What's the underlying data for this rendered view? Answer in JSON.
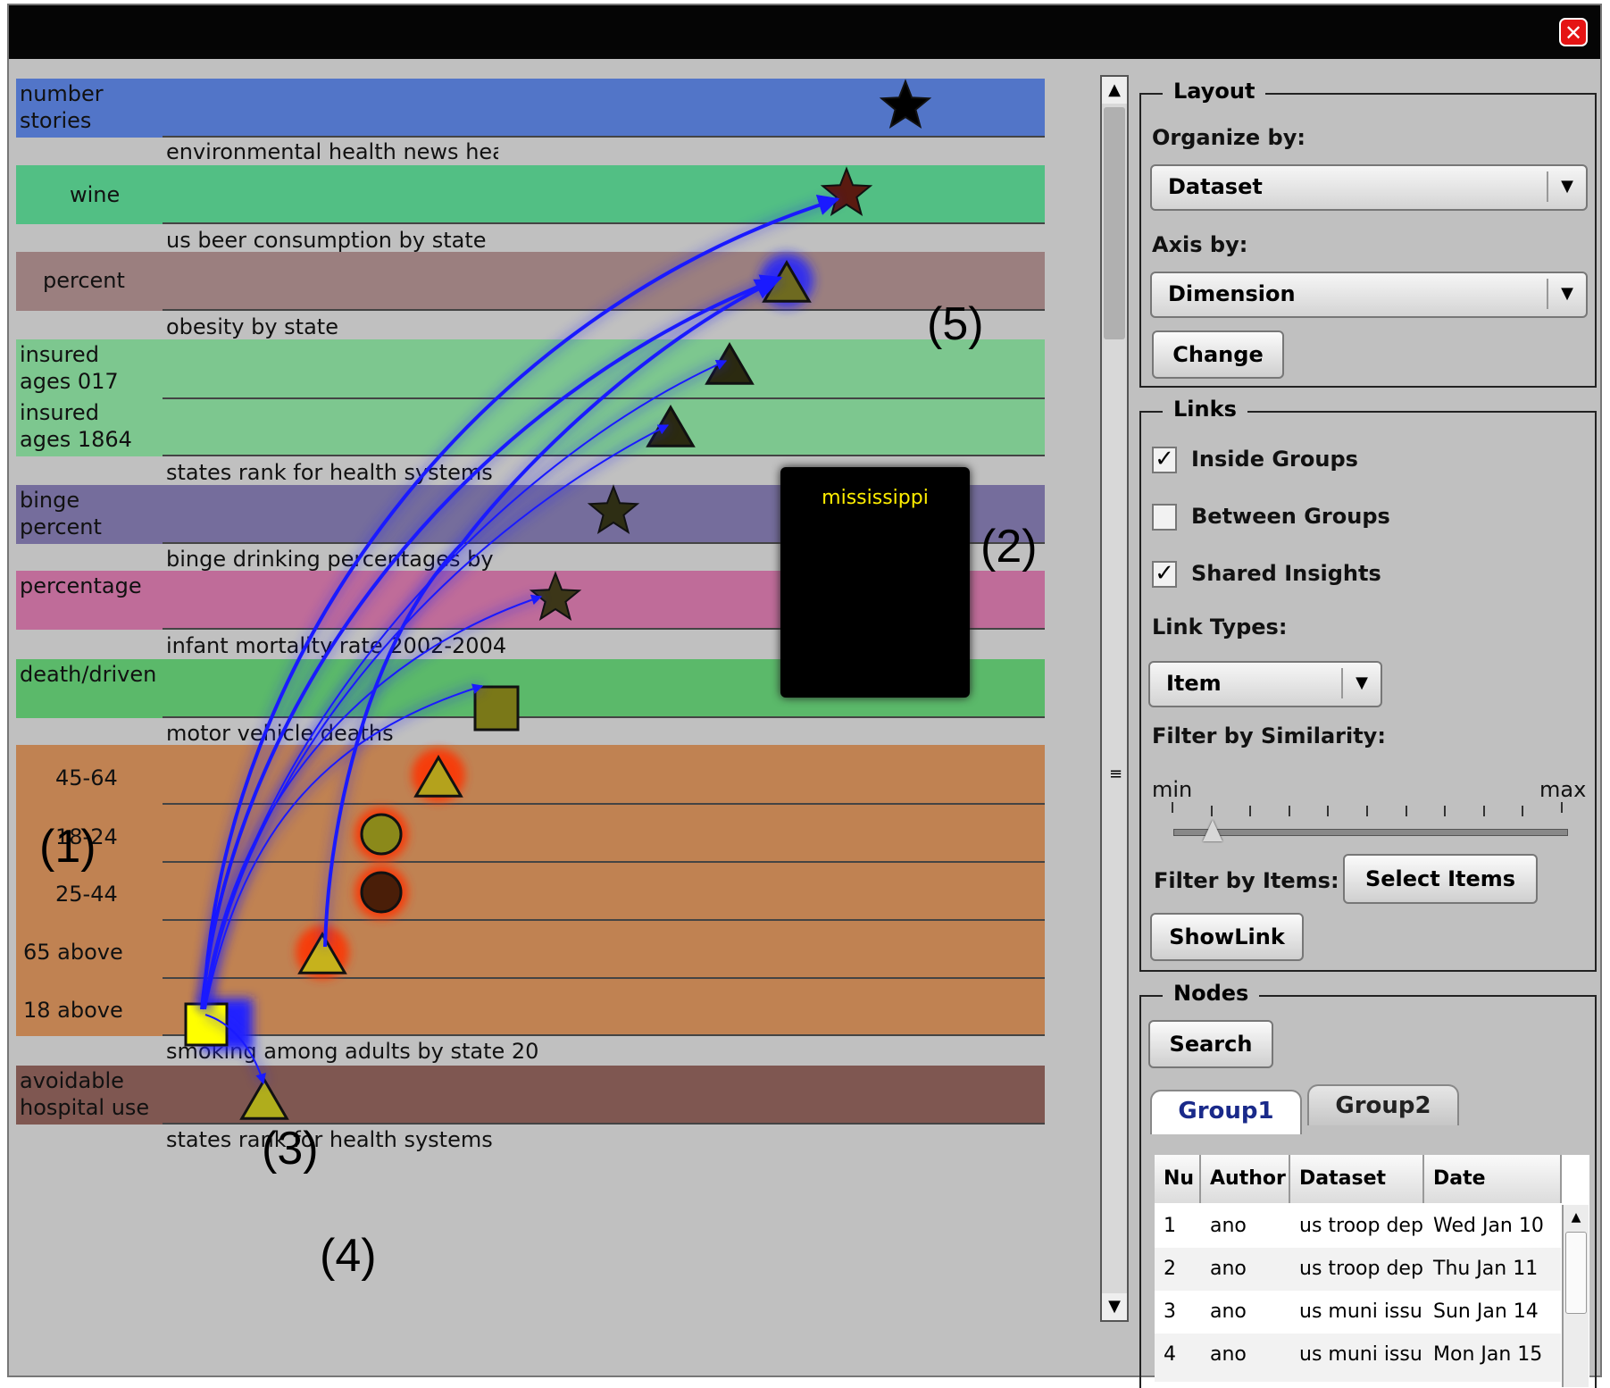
{
  "window": {
    "close_icon": "close-icon"
  },
  "viz": {
    "bands": [
      {
        "labels": [
          "number",
          "stories"
        ],
        "dataset": "environmental health news headlin",
        "color": "#5275c8"
      },
      {
        "labels": [
          "wine"
        ],
        "dataset": "us beer consumption by state",
        "color": "#52bf84"
      },
      {
        "labels": [
          "percent"
        ],
        "dataset": "obesity by state",
        "color": "#9b7f7f"
      },
      {
        "labels": [
          "insured",
          "ages 017",
          "insured",
          "ages 1864"
        ],
        "dataset": "states rank for health systems",
        "color": "#7dc78f"
      },
      {
        "labels": [
          "binge",
          "percent"
        ],
        "dataset": "binge drinking percentages by stat",
        "color": "#756d9c"
      },
      {
        "labels": [
          "percentage"
        ],
        "dataset": "infant mortality rate 2002-2004",
        "color": "#bf6c99"
      },
      {
        "labels": [
          "death/driven"
        ],
        "dataset": "motor vehicle deaths",
        "color": "#5bb96a"
      },
      {
        "labels": [
          "45-64",
          "18-24",
          "25-44",
          "65 above",
          "18 above"
        ],
        "dataset": "smoking among adults by state 20",
        "color": "#c08252"
      },
      {
        "labels": [
          "avoidable",
          "hospital use"
        ],
        "dataset": "states rank for health systems",
        "color": "#7f5751"
      }
    ],
    "tooltip_text": "mississippi",
    "annotations": [
      "(1)",
      "(2)",
      "(3)",
      "(4)",
      "(5)"
    ],
    "link_color": "#1a1aff",
    "highlight_colors": {
      "selected": "#2222ff",
      "related": "#ff3300"
    }
  },
  "panel": {
    "layout": {
      "legend": "Layout",
      "organize_label": "Organize by:",
      "organize_value": "Dataset",
      "axis_label": "Axis by:",
      "axis_value": "Dimension",
      "change_button": "Change"
    },
    "links": {
      "legend": "Links",
      "inside_groups": {
        "label": "Inside Groups",
        "checked": true
      },
      "between_groups": {
        "label": "Between Groups",
        "checked": false
      },
      "shared_insights": {
        "label": "Shared Insights",
        "checked": true
      },
      "link_types_label": "Link Types:",
      "link_types_value": "Item",
      "filter_similarity_label": "Filter by Similarity:",
      "slider_min": "min",
      "slider_max": "max",
      "slider_value": 0.1,
      "filter_items_label": "Filter by Items:",
      "select_items_button": "Select Items",
      "showlink_button": "ShowLink"
    },
    "nodes": {
      "legend": "Nodes",
      "search_button": "Search",
      "tabs": [
        "Group1",
        "Group2"
      ],
      "active_tab": "Group1",
      "columns": [
        "Nu",
        "Author",
        "Dataset",
        "Date"
      ],
      "rows": [
        [
          "1",
          "ano",
          "us troop dep",
          "Wed Jan 10"
        ],
        [
          "2",
          "ano",
          "us troop dep",
          "Thu Jan 11"
        ],
        [
          "3",
          "ano",
          "us muni issu",
          "Sun Jan 14"
        ],
        [
          "4",
          "ano",
          "us muni issu",
          "Mon Jan 15"
        ]
      ]
    }
  },
  "colors": {
    "titlebar": "#050505",
    "panel_bg": "#c0c0c0",
    "close": "#e51414"
  }
}
